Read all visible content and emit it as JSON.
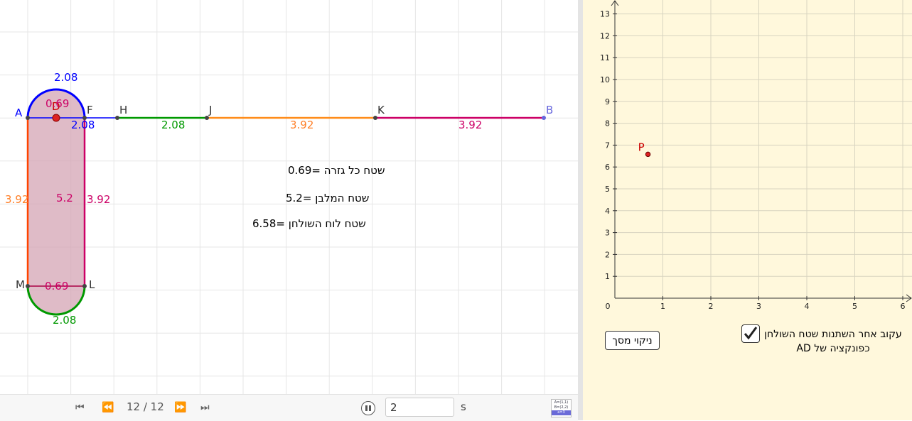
{
  "geometry_view": {
    "point_labels": {
      "A": "A",
      "D": "D",
      "F": "F",
      "H": "H",
      "J": "J",
      "K": "K",
      "B": "B",
      "M": "M",
      "L": "L"
    },
    "values": {
      "arc_top": "2.08",
      "seg_af": "2.08",
      "seg_hj": "2.08",
      "seg_jk": "3.92",
      "seg_kb": "3.92",
      "left_side": "3.92",
      "right_side": "3.92",
      "inner_top": "0.69",
      "inner_bottom": "0.69",
      "table_area": "5.2",
      "arc_bottom": "2.08"
    },
    "text_lines": [
      {
        "prefix": "0.69",
        "rtl": "שטח כל גזרה ="
      },
      {
        "prefix": "5.2",
        "rtl": "שטח המלבן = "
      },
      {
        "prefix": "6.58",
        "rtl": "שטח לוח השולחן = "
      }
    ],
    "colors": {
      "blue": "#0000ff",
      "green": "#009900",
      "orange": "#ff7f27",
      "magenta": "#cc0066",
      "red": "#cc0000",
      "fill": "#d4a4b4"
    }
  },
  "graph_view": {
    "y_ticks": [
      "1",
      "2",
      "3",
      "4",
      "5",
      "6",
      "7",
      "8",
      "9",
      "10",
      "11",
      "12",
      "13"
    ],
    "x_ticks": [
      "0",
      "1",
      "2",
      "3",
      "4",
      "5",
      "6"
    ],
    "point": {
      "label": "P",
      "x": 0.69,
      "y": 6.58
    }
  },
  "controls": {
    "clear_label": "ניקוי מסך",
    "checkbox_checked": true,
    "checkbox_label_line1": "עקוב אחר השתנות שטח השולחן",
    "checkbox_label_line2": "כפונקציה של AD"
  },
  "navbar": {
    "position": "12 / 12",
    "speed": "2",
    "unit": "s",
    "first_icon": "⏮",
    "prev_icon": "⏪",
    "next_icon": "⏩",
    "last_icon": "⏭",
    "algebra_icon_lines": [
      "A=(1,1)",
      "B=(2,2)",
      "a=3"
    ]
  }
}
